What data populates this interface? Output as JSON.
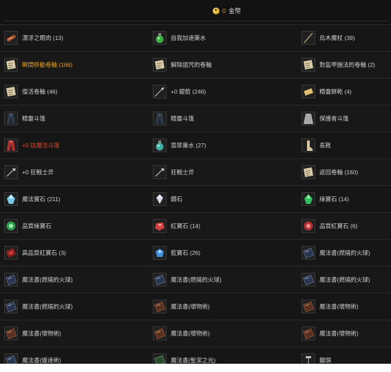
{
  "header": {
    "gold_amount": "0",
    "gold_label": "金幣"
  },
  "rows": [
    [
      {
        "name": "漂浮之眼肉 (13)",
        "icon": "meat-icon"
      },
      {
        "name": "自我加速藥水",
        "icon": "green-potion-icon"
      },
      {
        "name": "烏木魔杖 (39)",
        "icon": "wand-icon"
      }
    ],
    [
      {
        "name": "瞬間移動卷軸 (166)",
        "icon": "scroll-icon",
        "style": "gold"
      },
      {
        "name": "解除詛咒的卷軸",
        "icon": "scroll-icon"
      },
      {
        "name": "對盔甲施法的卷軸 (2)",
        "icon": "scroll-icon"
      }
    ],
    [
      {
        "name": "復活卷軸 (46)",
        "icon": "scroll-icon"
      },
      {
        "name": "+0 銀箭 (246)",
        "icon": "arrow-icon"
      },
      {
        "name": "精靈餅乾 (4)",
        "icon": "biscuit-icon"
      }
    ],
    [
      {
        "name": "精靈斗篷",
        "icon": "dark-cloak-icon"
      },
      {
        "name": "精靈斗篷",
        "icon": "dark-cloak-icon"
      },
      {
        "name": "保護者斗篷",
        "icon": "grey-cloak-icon"
      }
    ],
    [
      {
        "name": "+0 抗魔法斗篷",
        "icon": "red-cloak-icon",
        "style": "red"
      },
      {
        "name": "翡翠藥水 (27)",
        "icon": "emerald-potion-icon"
      },
      {
        "name": "長靴",
        "icon": "boots-icon"
      }
    ],
    [
      {
        "name": "+0 狂戰士斧",
        "icon": "axe-icon"
      },
      {
        "name": "狂戰士斧",
        "icon": "axe-icon"
      },
      {
        "name": "返回卷軸 (160)",
        "icon": "scroll-icon"
      }
    ],
    [
      {
        "name": "魔法寶石 (211)",
        "icon": "blue-gem-icon"
      },
      {
        "name": "鑽石",
        "icon": "diamond-icon"
      },
      {
        "name": "綠寶石 (14)",
        "icon": "green-gem-icon"
      }
    ],
    [
      {
        "name": "品質綠寶石",
        "icon": "green-orb-icon"
      },
      {
        "name": "紅寶石 (14)",
        "icon": "ruby-icon"
      },
      {
        "name": "品質紅寶石 (6)",
        "icon": "red-orb-icon"
      }
    ],
    [
      {
        "name": "高品質紅寶石 (3)",
        "icon": "red-card-icon"
      },
      {
        "name": "藍寶石 (26)",
        "icon": "sapphire-icon"
      },
      {
        "name": "魔法書(燃燒的火球)",
        "icon": "blue-book-icon"
      }
    ],
    [
      {
        "name": "魔法書(燃燒的火球)",
        "icon": "blue-book-icon"
      },
      {
        "name": "魔法書(燃燒的火球)",
        "icon": "blue-book-icon"
      },
      {
        "name": "魔法書(燃燒的火球)",
        "icon": "blue-book-icon"
      }
    ],
    [
      {
        "name": "魔法書(燃燒的火球)",
        "icon": "blue-book-icon"
      },
      {
        "name": "魔法書(壞物術)",
        "icon": "brown-book-icon"
      },
      {
        "name": "魔法書(壞物術)",
        "icon": "brown-book-icon"
      }
    ],
    [
      {
        "name": "魔法書(壞物術)",
        "icon": "brown-book-icon"
      },
      {
        "name": "魔法書(壞物術)",
        "icon": "brown-book-icon"
      },
      {
        "name": "魔法書(壞物術)",
        "icon": "brown-book-icon"
      }
    ],
    [
      {
        "name": "魔法書(緩速術)",
        "icon": "blue-book-icon"
      },
      {
        "name": "魔法書(聖潔之光)",
        "icon": "green-book-icon"
      },
      {
        "name": "鋤頭",
        "icon": "hoe-icon"
      }
    ]
  ]
}
